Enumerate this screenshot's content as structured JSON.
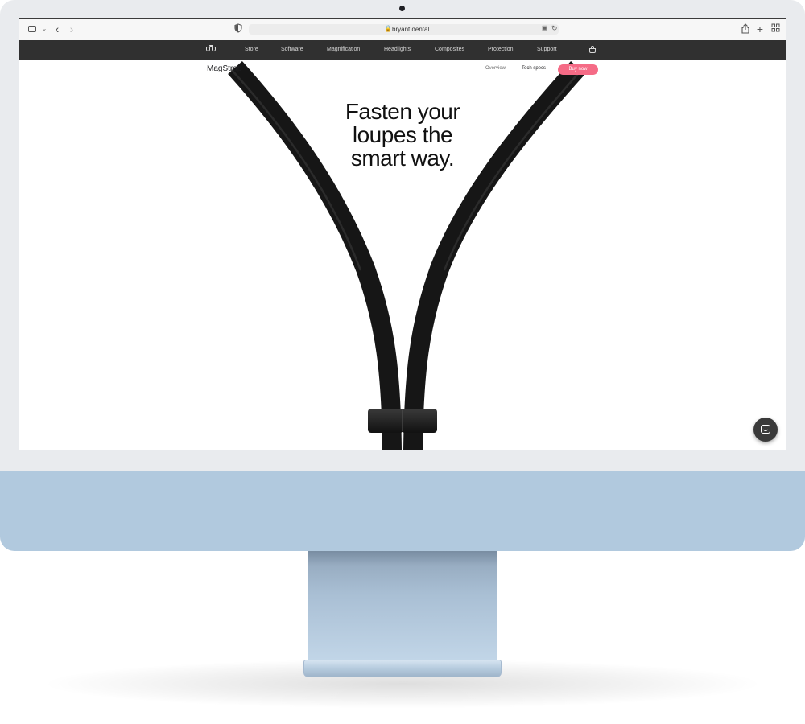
{
  "browser": {
    "url": "bryant.dental",
    "icons": [
      "sidebar-icon",
      "chevron-down-icon",
      "back-icon",
      "forward-icon",
      "shield-icon",
      "lock-icon",
      "translate-icon",
      "reload-icon",
      "share-icon",
      "new-tab-icon",
      "tab-overview-icon"
    ]
  },
  "site_nav": {
    "logo": "loupes-logo-icon",
    "items": [
      {
        "label": "Store"
      },
      {
        "label": "Software"
      },
      {
        "label": "Magnification"
      },
      {
        "label": "Headlights"
      },
      {
        "label": "Composites"
      },
      {
        "label": "Protection"
      },
      {
        "label": "Support"
      }
    ],
    "cart_icon": "basket-icon"
  },
  "subnav": {
    "title": "MagStrap",
    "overview_label": "Overview",
    "techspecs_label": "Tech specs",
    "buy_label": "Buy now",
    "buy_color": "#f56b86"
  },
  "hero": {
    "line1": "Fasten your",
    "line2": "loupes the",
    "line3": "smart way."
  },
  "chat_widget": {
    "icon": "chat-icon"
  },
  "device": {
    "chin_color": "#b1c9de"
  }
}
